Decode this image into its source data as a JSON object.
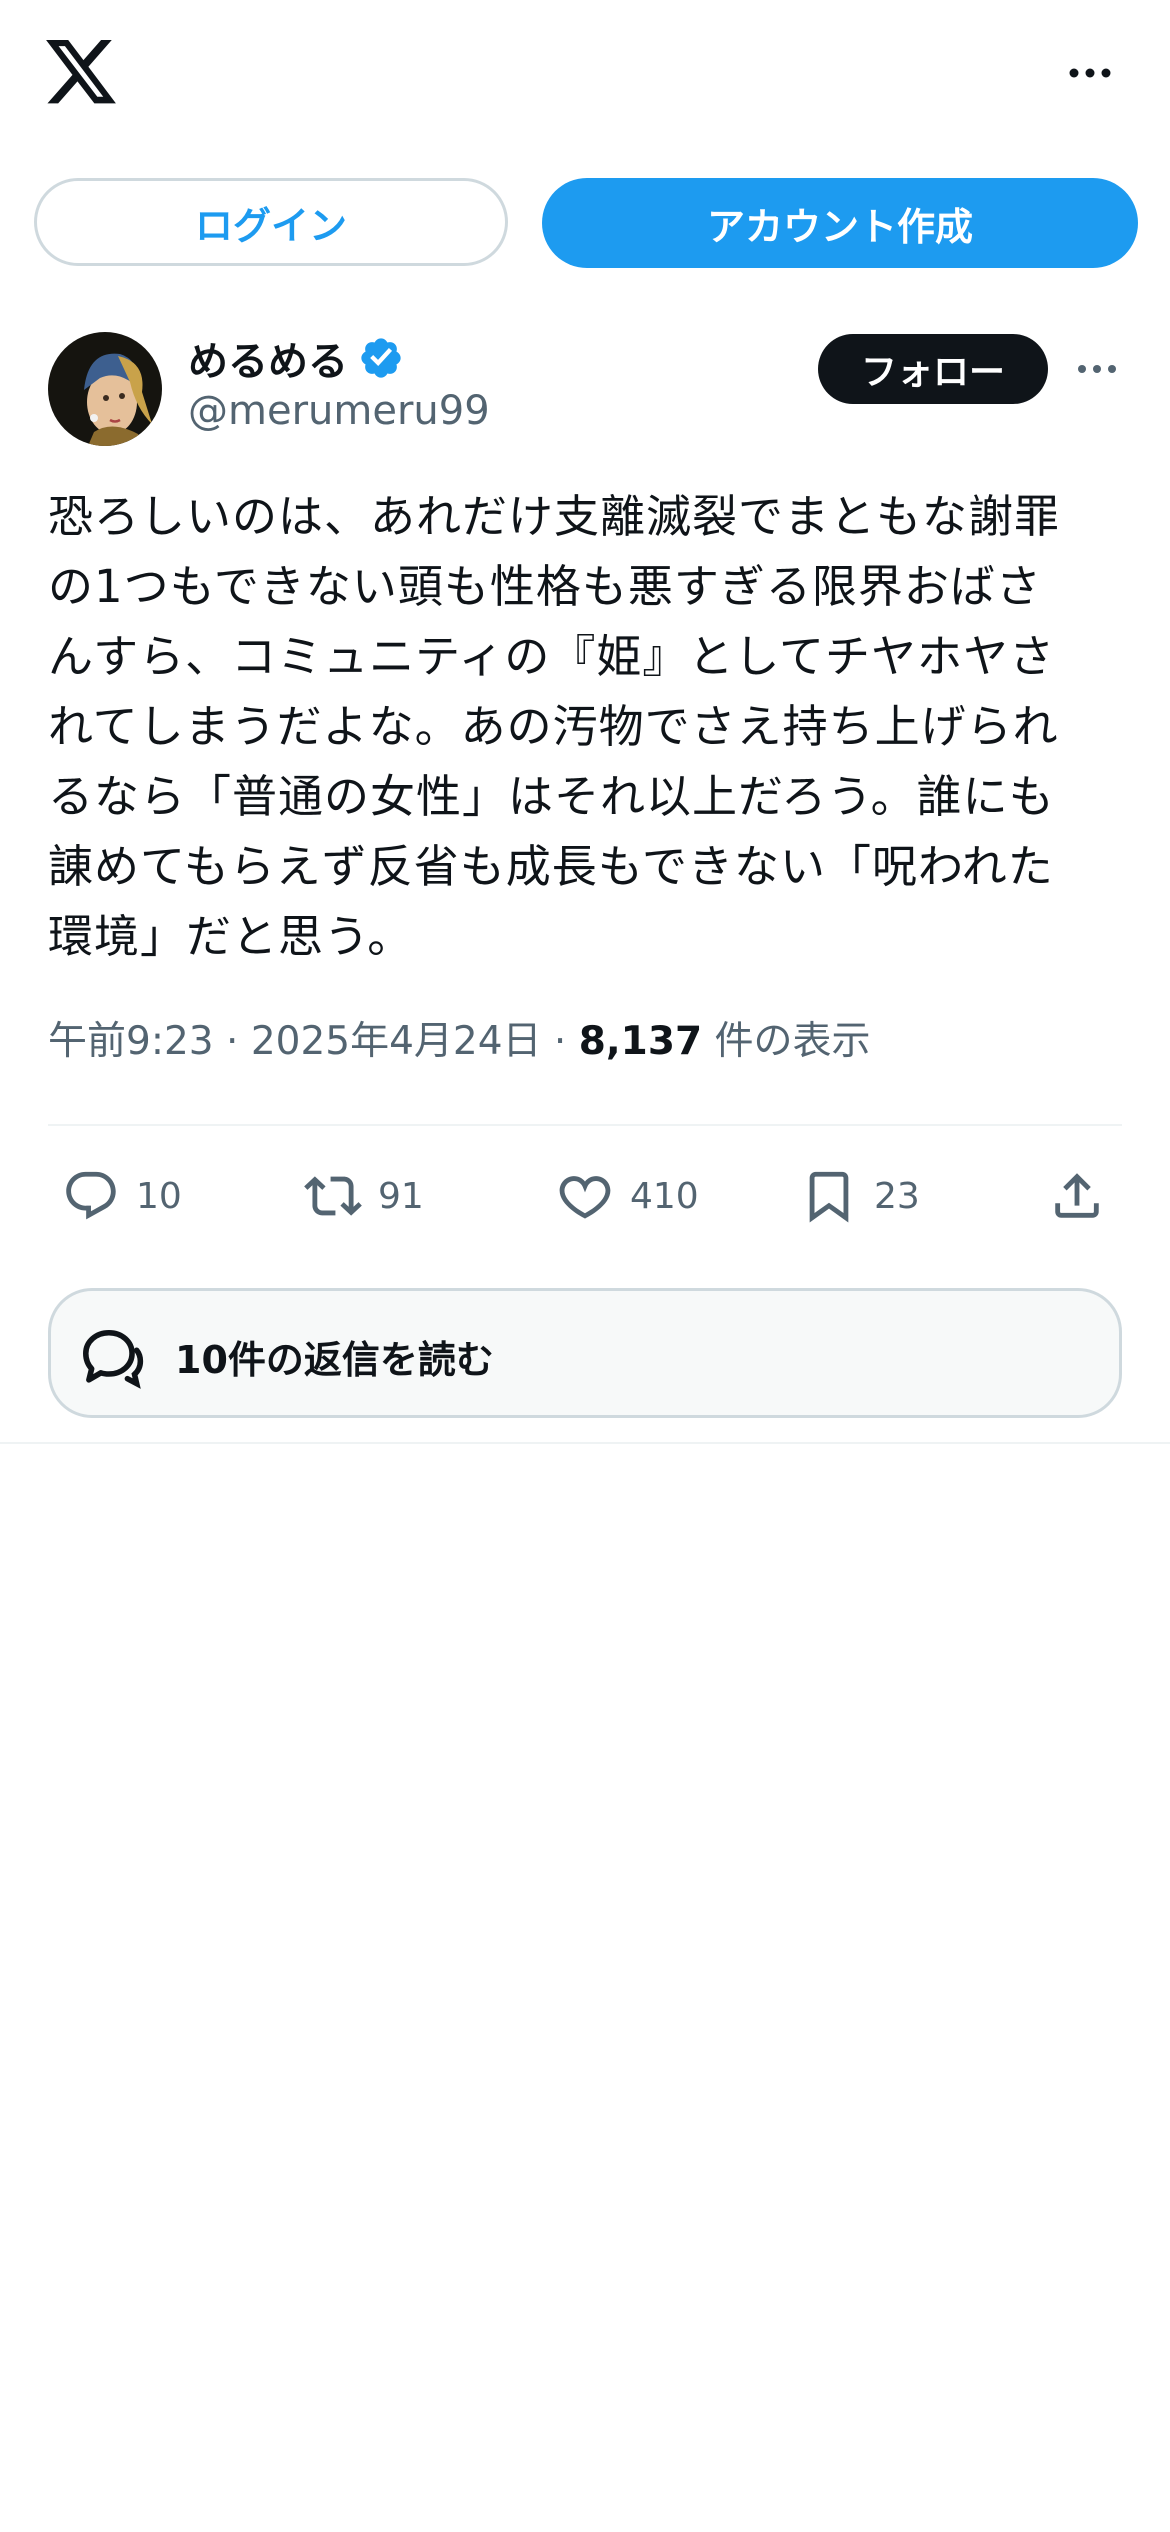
{
  "header": {
    "logo_icon": "x-logo-icon",
    "more_icon": "more-horizontal-icon"
  },
  "auth": {
    "login_label": "ログイン",
    "signup_label": "アカウント作成"
  },
  "tweet": {
    "display_name": "めるめる",
    "verified": true,
    "handle": "@merumeru99",
    "follow_label": "フォロー",
    "text": "恐ろしいのは、あれだけ支離滅裂でまともな謝罪\nの1つもできない頭も性格も悪すぎる限界おばさ\nんすら、コミュニティの『姫』としてチヤホヤさ\nれてしまうだよな。あの汚物でさえ持ち上げられ\nるなら「普通の女性」はそれ以上だろう。誰にも\n諌めてもらえず反省も成長もできない「呪われた\n環境」だと思う。",
    "time": "午前9:23",
    "sep1": "·",
    "date": "2025年4月24日",
    "sep2": "·",
    "views_count": "8,137",
    "views_label": "件の表示",
    "metrics": {
      "replies": "10",
      "retweets": "91",
      "likes": "410",
      "bookmarks": "23"
    },
    "read_replies_label": "10件の返信を読む"
  },
  "colors": {
    "accent": "#1d9bf0",
    "text": "#0f1419",
    "muted": "#536471",
    "border": "#cfd9de"
  }
}
